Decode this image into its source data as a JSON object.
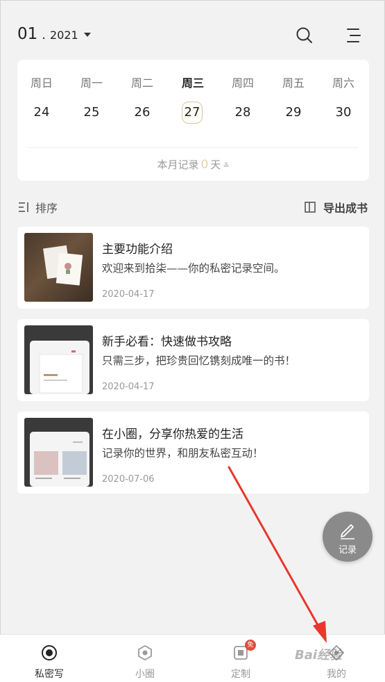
{
  "header": {
    "month": "01",
    "dot": ".",
    "year": "2021"
  },
  "calendar": {
    "weekdays": [
      "周日",
      "周一",
      "周二",
      "周三",
      "周四",
      "周五",
      "周六"
    ],
    "dates": [
      "24",
      "25",
      "26",
      "27",
      "28",
      "29",
      "30"
    ],
    "active_index": 3,
    "record_prefix": "本月记录",
    "record_count": "0",
    "record_suffix": "天"
  },
  "toolbar": {
    "sort_label": "排序",
    "export_label": "导出成书"
  },
  "cards": [
    {
      "title": "主要功能介绍",
      "desc": "欢迎来到拾柒——你的私密记录空间。",
      "date": "2020-04-17"
    },
    {
      "title": "新手必看：快速做书攻略",
      "desc": "只需三步，把珍贵回忆镌刻成唯一的书！",
      "date": "2020-04-17"
    },
    {
      "title": "在小圈，分享你热爱的生活",
      "desc": "记录你的世界，和朋友私密互动！",
      "date": "2020-07-06"
    }
  ],
  "fab": {
    "label": "记录"
  },
  "nav": {
    "items": [
      {
        "label": "私密写"
      },
      {
        "label": "小圈"
      },
      {
        "label": "定制"
      },
      {
        "label": "我的"
      }
    ],
    "active_index": 0,
    "badge": "免"
  },
  "watermark": "Bai经验",
  "colors": {
    "accent_gold": "#e3d3a8",
    "fab_gray": "#8a8a8a",
    "badge_red": "#e24b3b",
    "annotation_arrow": "#e8372b"
  }
}
